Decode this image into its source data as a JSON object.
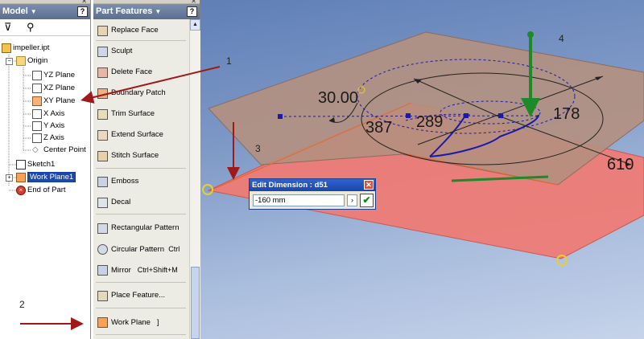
{
  "model_panel": {
    "title": "Model",
    "nodes": [
      {
        "label": "impeller.ipt"
      },
      {
        "label": "Origin"
      },
      {
        "label": "YZ Plane"
      },
      {
        "label": "XZ Plane"
      },
      {
        "label": "XY Plane"
      },
      {
        "label": "X Axis"
      },
      {
        "label": "Y Axis"
      },
      {
        "label": "Z Axis"
      },
      {
        "label": "Center Point"
      },
      {
        "label": "Sketch1"
      },
      {
        "label": "Work Plane1"
      },
      {
        "label": "End of Part"
      }
    ]
  },
  "feature_panel": {
    "title": "Part Features",
    "items": [
      {
        "label": "Replace Face",
        "shortcut": ""
      },
      {
        "label": "Sculpt",
        "shortcut": ""
      },
      {
        "label": "Delete Face",
        "shortcut": ""
      },
      {
        "label": "Boundary Patch",
        "shortcut": ""
      },
      {
        "label": "Trim Surface",
        "shortcut": ""
      },
      {
        "label": "Extend Surface",
        "shortcut": ""
      },
      {
        "label": "Stitch Surface",
        "shortcut": ""
      },
      {
        "label": "Emboss",
        "shortcut": ""
      },
      {
        "label": "Decal",
        "shortcut": ""
      },
      {
        "label": "Rectangular Pattern",
        "shortcut": ""
      },
      {
        "label": "Circular Pattern",
        "shortcut": "Ctrl"
      },
      {
        "label": "Mirror",
        "shortcut": "Ctrl+Shift+M"
      },
      {
        "label": "Place Feature...",
        "shortcut": ""
      },
      {
        "label": "Work Plane",
        "shortcut": "]"
      }
    ]
  },
  "viewport": {
    "dimensions": {
      "angle": "30.00",
      "d387": "387",
      "d289": "289",
      "d178": "178",
      "d610": "610"
    },
    "annotations": {
      "a1": "1",
      "a2": "2",
      "a3": "3",
      "a4": "4"
    }
  },
  "edit_dimension": {
    "title": "Edit Dimension : d51",
    "value": "-160 mm"
  },
  "colors": {
    "annotation_arrow": "#a01818",
    "green_arrow": "#1d8a2a",
    "plane_top": "#b49080",
    "plane_bottom": "#f07a72",
    "sketch_blue": "#1a1aa8"
  },
  "icons": {
    "filter": "filter-icon",
    "find": "binoculars-icon",
    "help": "help-icon",
    "close": "close-icon"
  }
}
